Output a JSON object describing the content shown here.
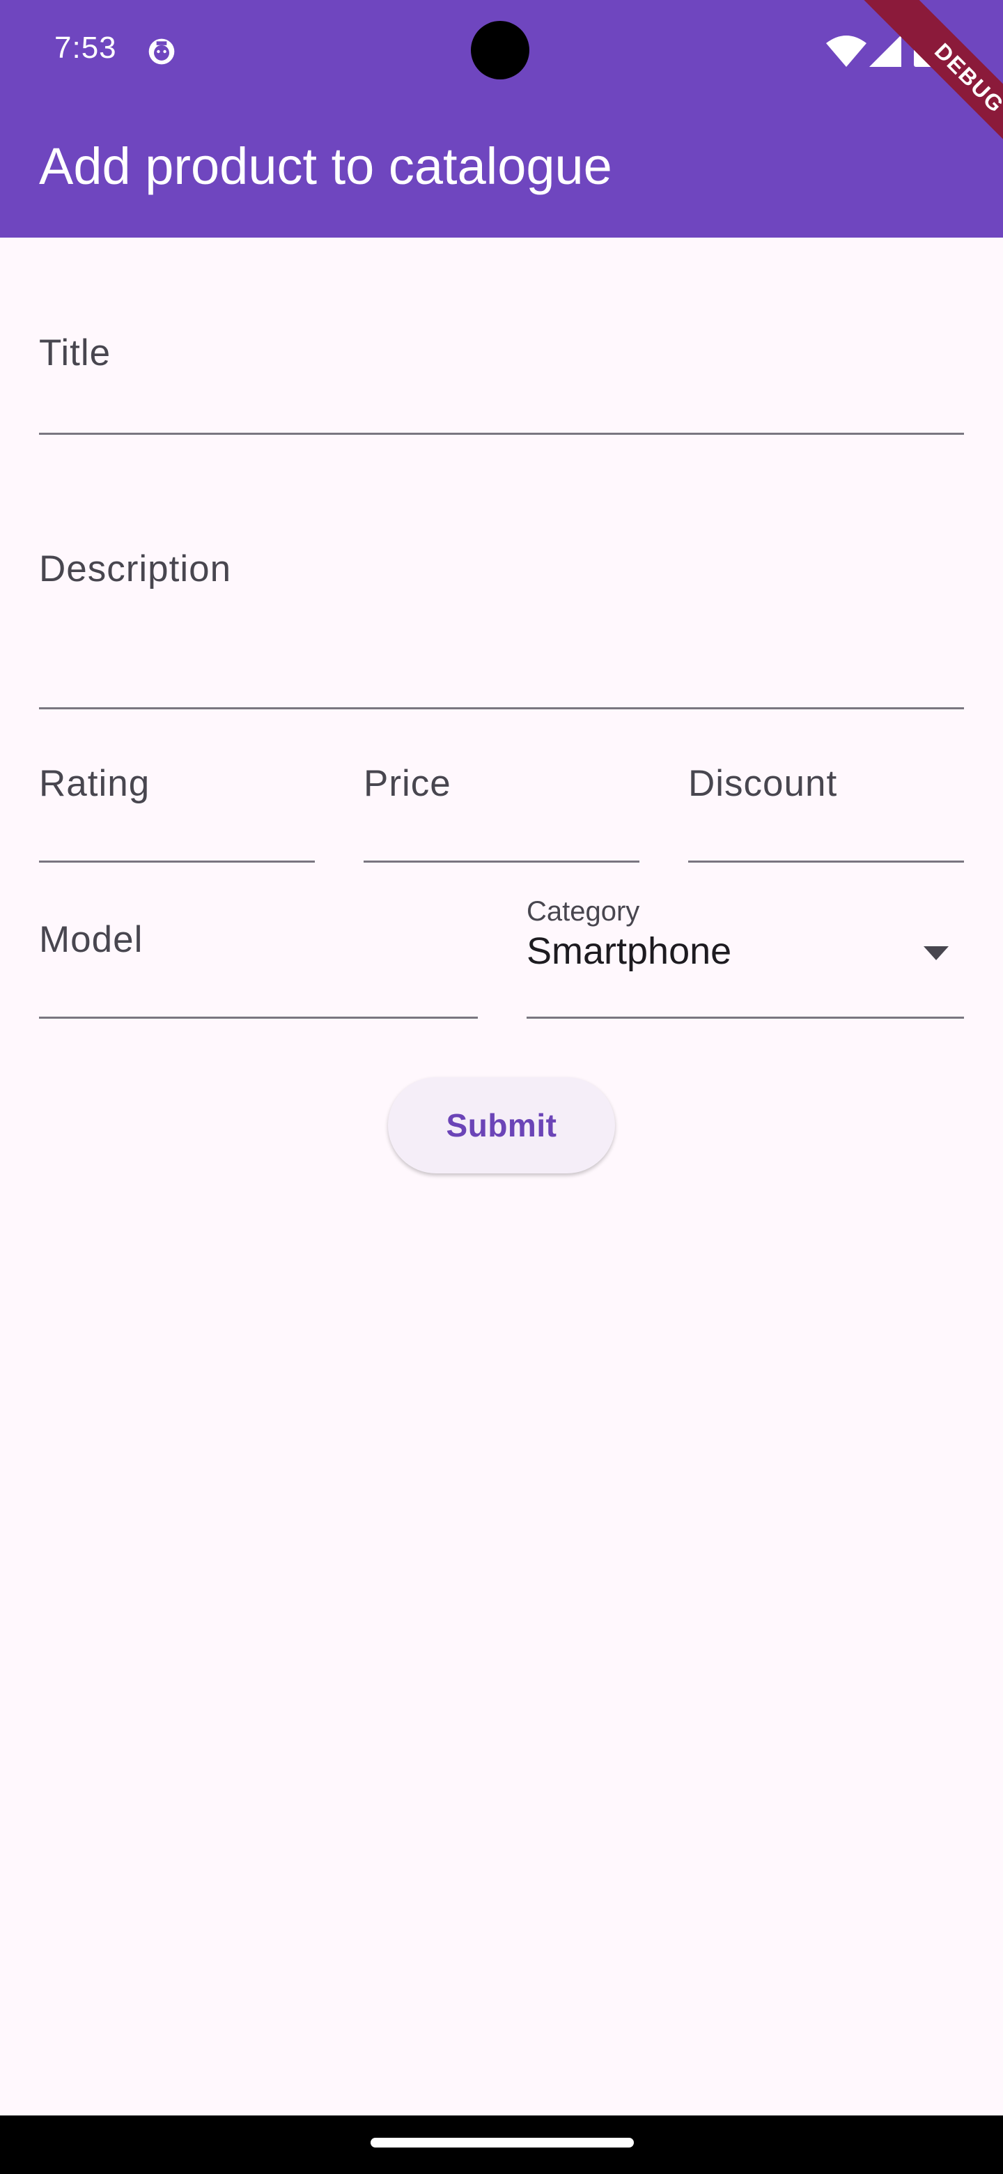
{
  "status_bar": {
    "time": "7:53",
    "icons": [
      "app-notification-icon",
      "wifi-icon",
      "signal-icon",
      "battery-icon"
    ]
  },
  "debug_banner": "DEBUG",
  "app_bar": {
    "title": "Add product to catalogue",
    "background_color": "#6F46BF"
  },
  "form": {
    "title_field": {
      "label": "Title",
      "value": ""
    },
    "description_field": {
      "label": "Description",
      "value": ""
    },
    "rating_field": {
      "label": "Rating",
      "value": ""
    },
    "price_field": {
      "label": "Price",
      "value": ""
    },
    "discount_field": {
      "label": "Discount",
      "value": ""
    },
    "model_field": {
      "label": "Model",
      "value": ""
    },
    "category_dropdown": {
      "label": "Category",
      "selected": "Smartphone"
    },
    "submit_label": "Submit"
  },
  "colors": {
    "accent": "#6B44B7",
    "background": "#FFF8FD",
    "button_background": "#F5EEF8"
  }
}
